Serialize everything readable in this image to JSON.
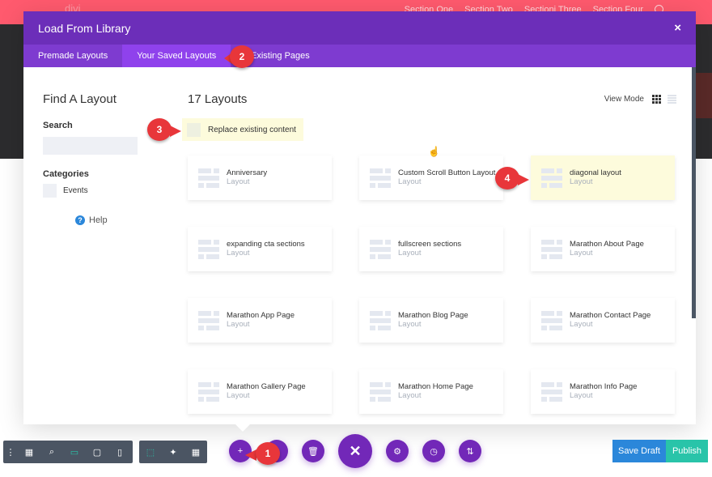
{
  "site": {
    "logo": "divi",
    "nav": [
      "Section One",
      "Section Two",
      "Sectioni Three",
      "Section Four"
    ]
  },
  "modal": {
    "title": "Load From Library",
    "close_label": "×",
    "tabs": [
      {
        "label": "Premade Layouts",
        "active": false
      },
      {
        "label": "Your Saved Layouts",
        "active": true
      },
      {
        "label": "Your Existing Pages",
        "active": false,
        "visible_text": "r Existing Pages"
      }
    ],
    "sidebar": {
      "heading": "Find A Layout",
      "search_label": "Search",
      "search_value": "",
      "categories_label": "Categories",
      "categories": [
        "Events"
      ],
      "help_label": "Help"
    },
    "main": {
      "count_label": "17 Layouts",
      "view_mode_label": "View Mode",
      "replace_label": "Replace existing content",
      "layouts": [
        {
          "title": "Anniversary",
          "type": "Layout",
          "highlighted": false
        },
        {
          "title": "Custom Scroll Button Layout",
          "type": "Layout",
          "highlighted": false
        },
        {
          "title": "diagonal layout",
          "type": "Layout",
          "highlighted": true
        },
        {
          "title": "expanding cta sections",
          "type": "Layout",
          "highlighted": false
        },
        {
          "title": "fullscreen sections",
          "type": "Layout",
          "highlighted": false
        },
        {
          "title": "Marathon About Page",
          "type": "Layout",
          "highlighted": false
        },
        {
          "title": "Marathon App Page",
          "type": "Layout",
          "highlighted": false
        },
        {
          "title": "Marathon Blog Page",
          "type": "Layout",
          "highlighted": false
        },
        {
          "title": "Marathon Contact Page",
          "type": "Layout",
          "highlighted": false
        },
        {
          "title": "Marathon Gallery Page",
          "type": "Layout",
          "highlighted": false
        },
        {
          "title": "Marathon Home Page",
          "type": "Layout",
          "highlighted": false
        },
        {
          "title": "Marathon Info Page",
          "type": "Layout",
          "highlighted": false
        }
      ]
    }
  },
  "callouts": [
    "1",
    "2",
    "3",
    "4"
  ],
  "toolbar": {
    "left_icons": [
      "menu-dots-icon",
      "wireframe-icon",
      "zoom-icon",
      "desktop-icon",
      "tablet-icon",
      "phone-icon"
    ],
    "mid_icons": [
      "select-icon",
      "click-mode-icon",
      "grid-icon"
    ],
    "add_label": "+",
    "close_label": "✕",
    "save_draft": "Save Draft",
    "publish": "Publish"
  },
  "colors": {
    "brand_purple": "#6c2eb9",
    "tab_purple": "#7e3bd0",
    "active_tab": "#8f42ec",
    "save_draft": "#2b87da",
    "publish": "#29c4a9",
    "callout_red": "#e8363a",
    "highlight_yellow": "#fdfbdc",
    "site_header": "#ff5a6e"
  }
}
